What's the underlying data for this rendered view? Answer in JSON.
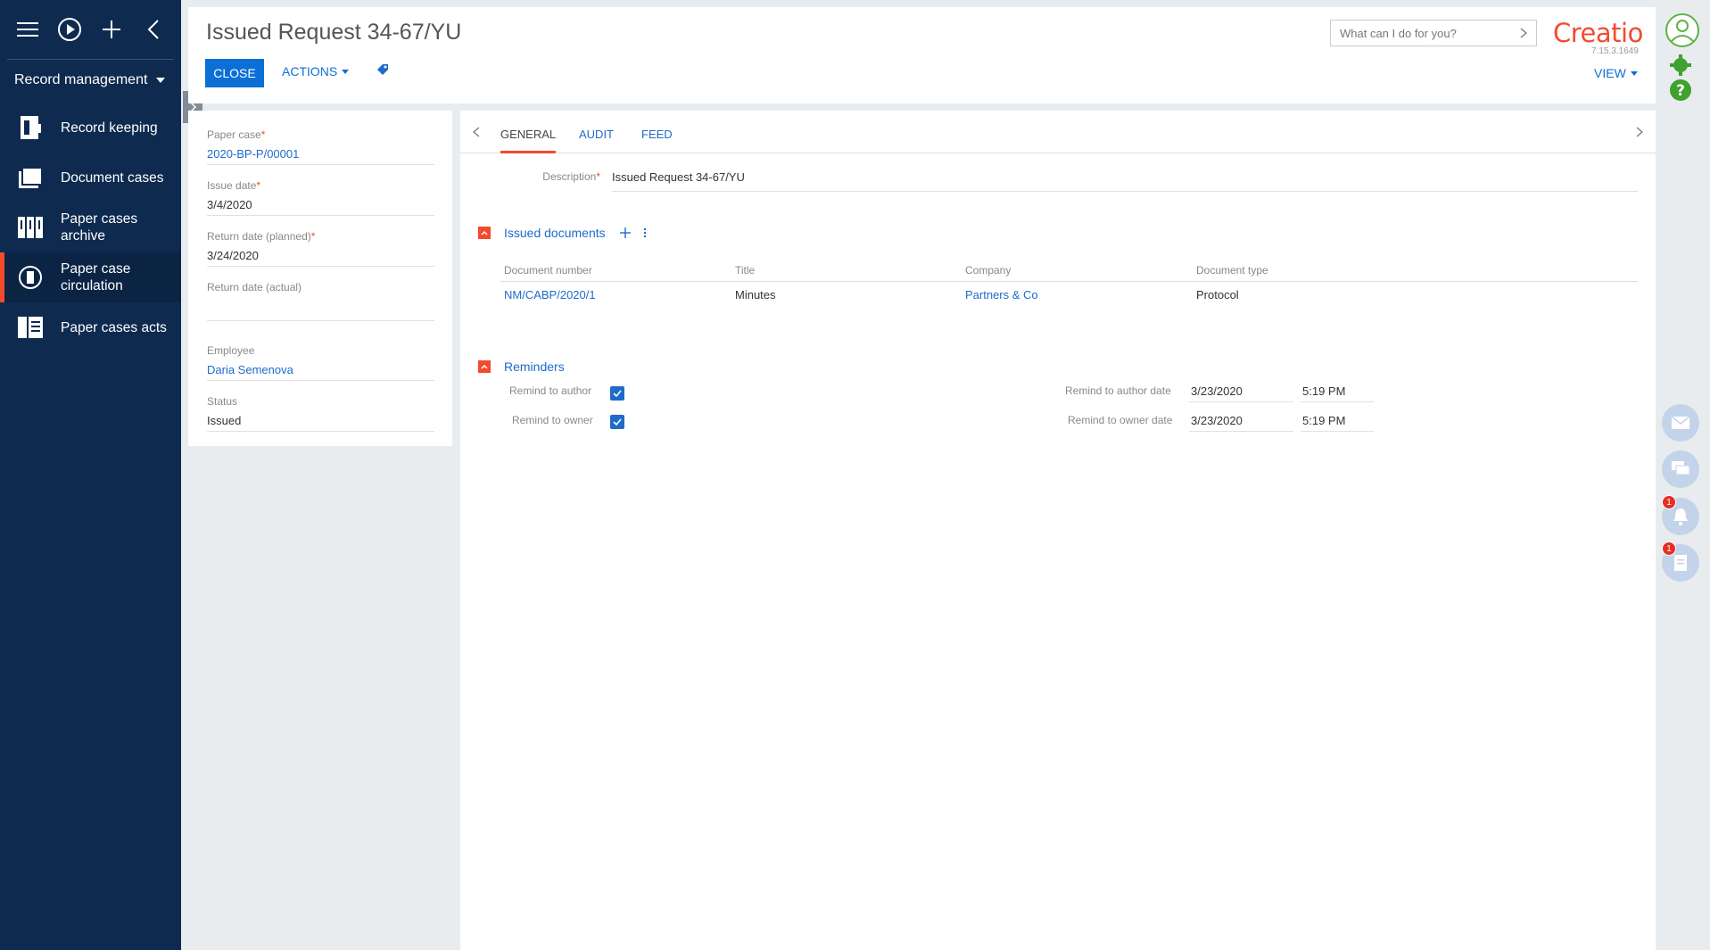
{
  "nav": {
    "section": "Record management",
    "items": [
      {
        "label": "Record keeping",
        "icon": "record-keeping-icon"
      },
      {
        "label": "Document cases",
        "icon": "folders-icon"
      },
      {
        "label": "Paper cases archive",
        "icon": "archive-icon"
      },
      {
        "label": "Paper case circulation",
        "icon": "circulation-icon",
        "active": true
      },
      {
        "label": "Paper cases acts",
        "icon": "acts-icon"
      }
    ]
  },
  "header": {
    "title": "Issued Request 34-67/YU",
    "close_label": "CLOSE",
    "actions_label": "ACTIONS",
    "search_placeholder": "What can I do for you?",
    "logo": "Creatio",
    "version": "7.15.3.1649",
    "view_label": "VIEW"
  },
  "profile": {
    "paper_case": {
      "label": "Paper case",
      "value": "2020-BP-P/00001"
    },
    "issue_date": {
      "label": "Issue date",
      "value": "3/4/2020"
    },
    "return_planned": {
      "label": "Return date (planned)",
      "value": "3/24/2020"
    },
    "return_actual": {
      "label": "Return date (actual)",
      "value": ""
    },
    "employee": {
      "label": "Employee",
      "value": "Daria Semenova"
    },
    "status": {
      "label": "Status",
      "value": "Issued"
    }
  },
  "tabs": [
    "GENERAL",
    "AUDIT",
    "FEED"
  ],
  "description": {
    "label": "Description",
    "value": "Issued Request 34-67/YU"
  },
  "issued_documents": {
    "title": "Issued documents",
    "columns": [
      "Document number",
      "Title",
      "Company",
      "Document type"
    ],
    "rows": [
      {
        "number": "NM/CABP/2020/1",
        "title": "Minutes",
        "company": "Partners & Co",
        "type": "Protocol"
      }
    ]
  },
  "reminders": {
    "title": "Reminders",
    "author_label": "Remind to author",
    "owner_label": "Remind to owner",
    "author_date_label": "Remind to author date",
    "owner_date_label": "Remind to owner date",
    "author_date": "3/23/2020",
    "author_time": "5:19 PM",
    "owner_date": "3/23/2020",
    "owner_time": "5:19 PM"
  },
  "rail": {
    "notifications_count": "1",
    "tasks_count": "1"
  },
  "colors": {
    "accent": "#f24b2c",
    "primary": "#0b6fd6",
    "nav_bg": "#0e2a4f"
  }
}
